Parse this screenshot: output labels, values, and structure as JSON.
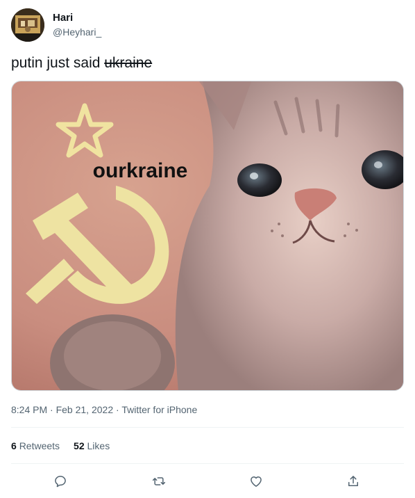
{
  "user": {
    "name": "Hari",
    "handle": "@Heyhari_"
  },
  "tweet": {
    "text_prefix": "putin just said ",
    "text_struck": "ukraine",
    "image_caption": "ourkraine"
  },
  "meta": {
    "time": "8:24 PM",
    "sep1": " · ",
    "date": "Feb 21, 2022",
    "sep2": " · ",
    "source": "Twitter for iPhone"
  },
  "stats": {
    "retweets_count": "6",
    "retweets_label": "Retweets",
    "likes_count": "52",
    "likes_label": "Likes"
  },
  "actions": [
    "reply-icon",
    "retweet-icon",
    "like-icon",
    "share-icon"
  ],
  "colors": {
    "text": "#0f1419",
    "secondary": "#536471",
    "divider": "#eff3f4",
    "media_border": "#cfd9de"
  }
}
